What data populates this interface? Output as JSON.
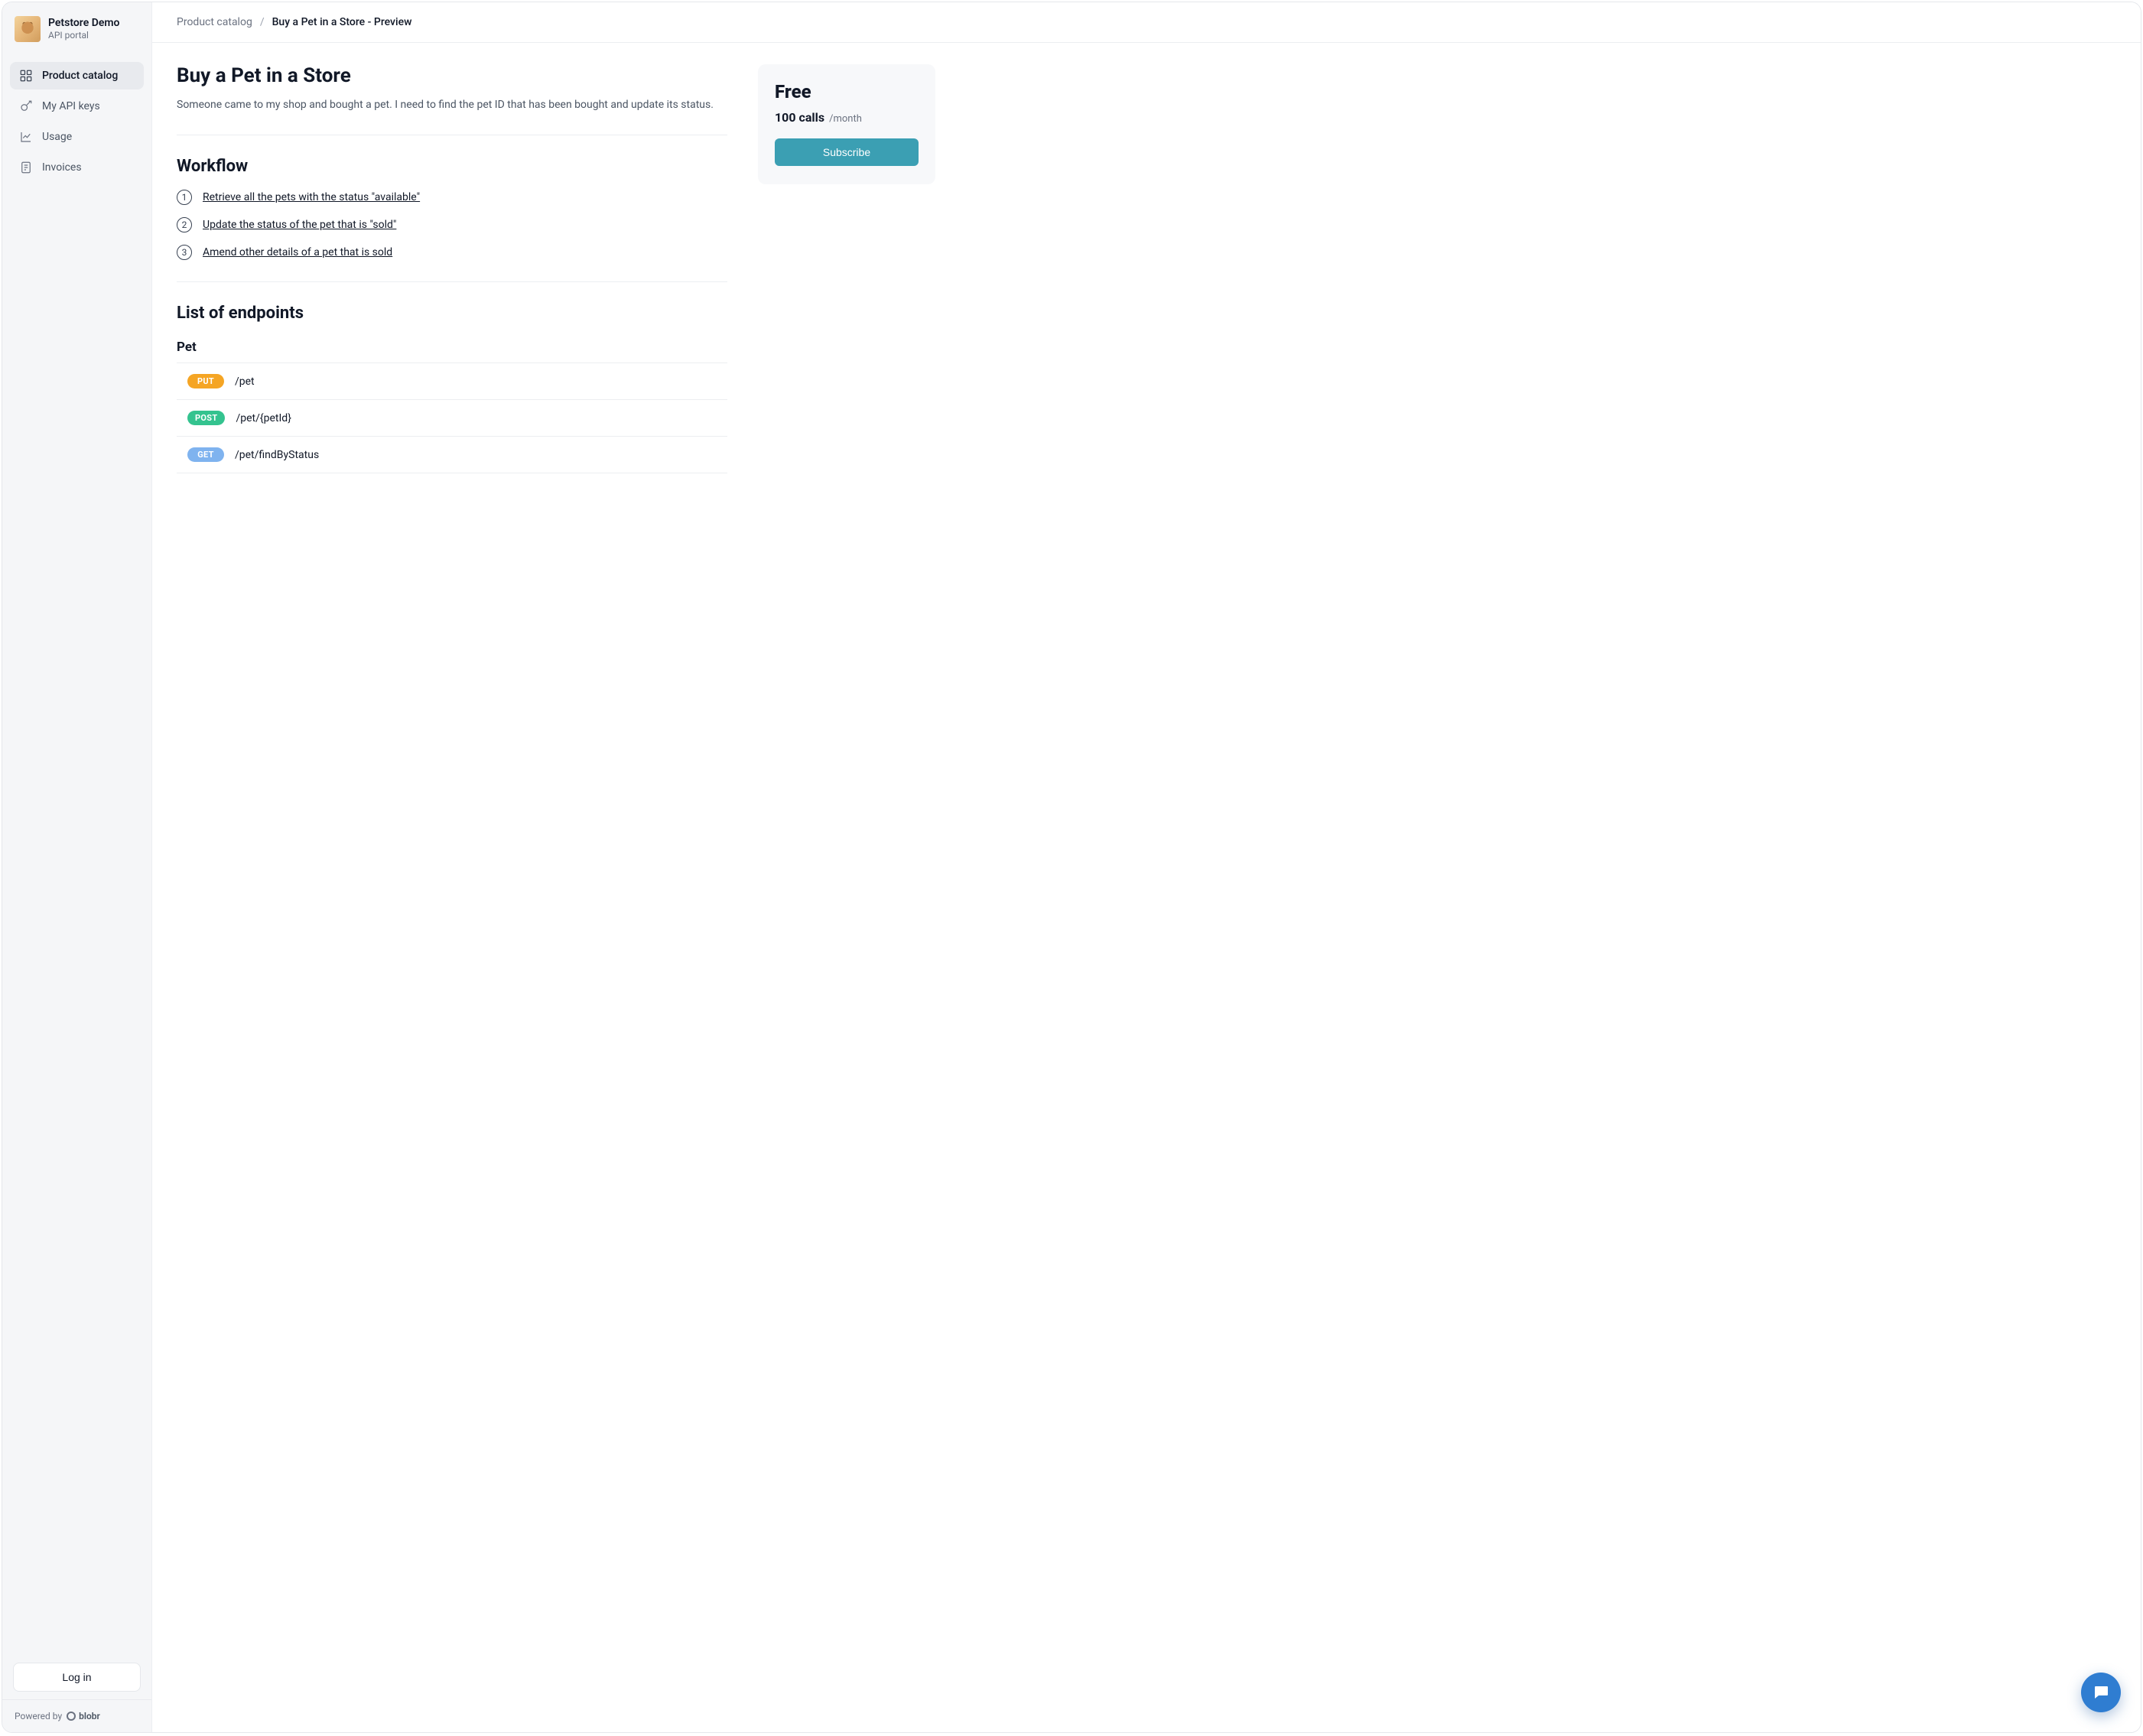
{
  "brand": {
    "title": "Petstore Demo",
    "subtitle": "API portal",
    "logo_icon": "dog-photo"
  },
  "sidebar": {
    "items": [
      {
        "icon": "grid-icon",
        "label": "Product catalog",
        "active": true
      },
      {
        "icon": "key-icon",
        "label": "My API keys",
        "active": false
      },
      {
        "icon": "chart-icon",
        "label": "Usage",
        "active": false
      },
      {
        "icon": "invoice-icon",
        "label": "Invoices",
        "active": false
      }
    ],
    "login_label": "Log in",
    "powered_prefix": "Powered by",
    "powered_brand": "blobr"
  },
  "breadcrumb": {
    "root": "Product catalog",
    "separator": "/",
    "current": "Buy a Pet in a Store - Preview"
  },
  "page": {
    "title": "Buy a Pet in a Store",
    "description": "Someone came to my shop and bought a pet. I need to find the pet ID that has been bought and update its status."
  },
  "workflow": {
    "heading": "Workflow",
    "steps": [
      "Retrieve all the pets with the status \"available\"",
      "Update the status of the pet that is \"sold\"",
      "Amend other details of a pet that is sold"
    ]
  },
  "endpoints": {
    "heading": "List of endpoints",
    "groups": [
      {
        "name": "Pet",
        "items": [
          {
            "method": "PUT",
            "method_class": "put",
            "path": "/pet"
          },
          {
            "method": "POST",
            "method_class": "post",
            "path": "/pet/{petId}"
          },
          {
            "method": "GET",
            "method_class": "get",
            "path": "/pet/findByStatus"
          }
        ]
      }
    ]
  },
  "plan": {
    "name": "Free",
    "quota": "100 calls",
    "period": "/month",
    "cta": "Subscribe"
  },
  "fab": {
    "name": "chat-icon"
  }
}
